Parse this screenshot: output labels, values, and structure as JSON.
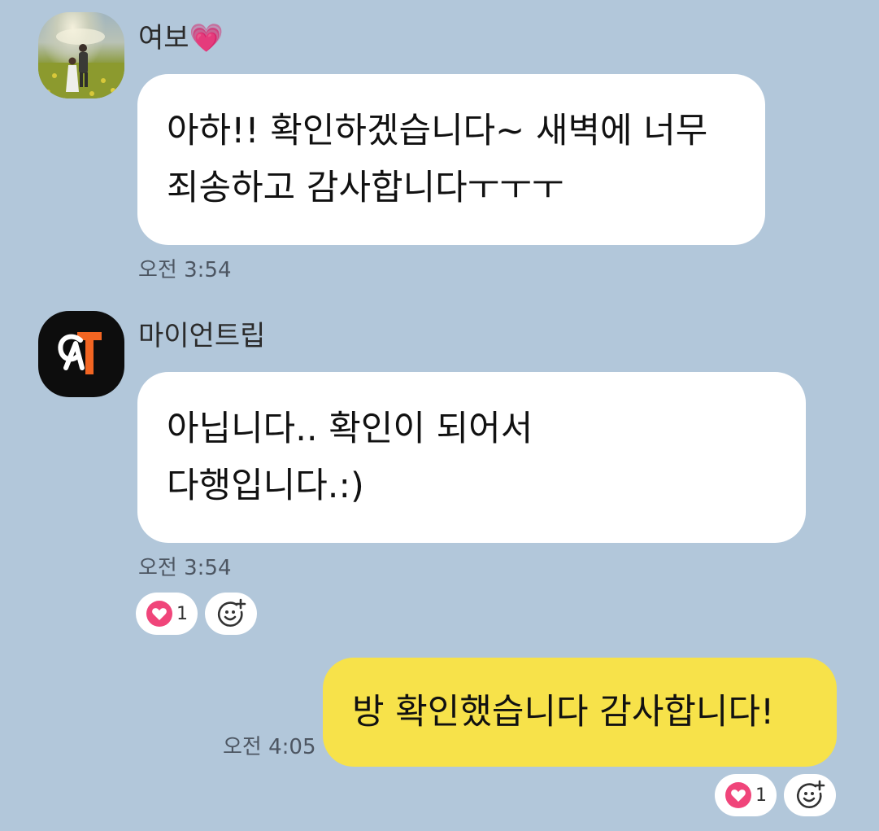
{
  "messages": [
    {
      "sender": "여보💗",
      "lines": [
        "아하!! 확인하겠습니다~ 새벽에 너무",
        "죄송하고 감사합니다ㅜㅜㅜ"
      ],
      "time": "오전 3:54"
    },
    {
      "sender": "마이언트립",
      "lines": [
        "아닙니다.. 확인이 되어서",
        "다행입니다.:)"
      ],
      "time": "오전 3:54",
      "reaction": {
        "icon": "heart-icon",
        "count": "1"
      }
    },
    {
      "sender": "",
      "lines": [
        "방 확인했습니다 감사합니다!"
      ],
      "time": "오전 4:05",
      "reaction": {
        "icon": "heart-icon",
        "count": "1"
      }
    }
  ],
  "colors": {
    "background": "#b2c7da",
    "bubble_incoming": "#ffffff",
    "bubble_outgoing": "#f7e24a",
    "heart": "#f0457a",
    "logo_accent": "#f26522"
  },
  "icons": {
    "add_reaction": "add-reaction-smiley-icon",
    "heart": "heart-icon",
    "logo": "myontrip-logo-icon"
  }
}
